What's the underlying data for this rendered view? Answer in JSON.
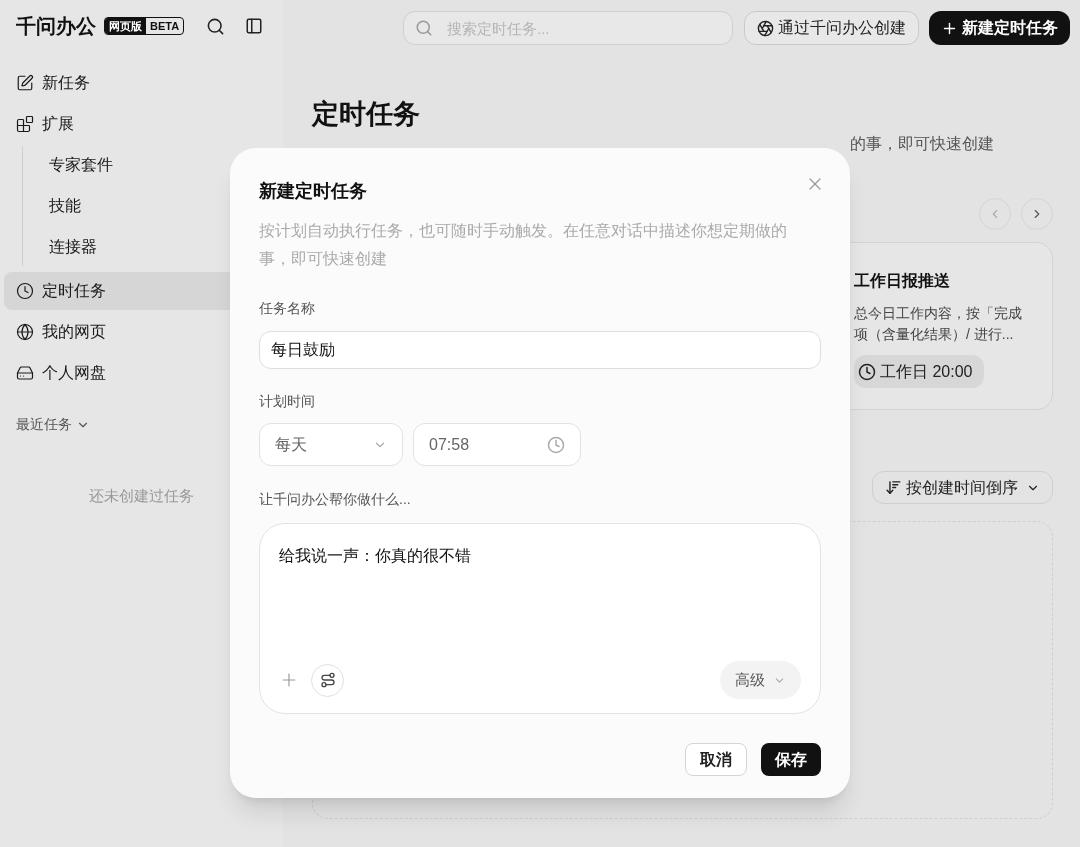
{
  "app": {
    "logo": "千问办公",
    "edition": "网页版",
    "stage": "BETA"
  },
  "sidebar": {
    "items": [
      {
        "label": "新任务",
        "selected": false
      },
      {
        "label": "扩展",
        "selected": false,
        "children": [
          {
            "label": "专家套件",
            "selected": false
          },
          {
            "label": "技能",
            "selected": false
          },
          {
            "label": "连接器",
            "selected": false
          }
        ]
      },
      {
        "label": "定时任务",
        "selected": true
      },
      {
        "label": "我的网页",
        "selected": false
      },
      {
        "label": "个人网盘",
        "selected": false
      }
    ],
    "recent": {
      "label": "最近任务",
      "empty_text": "还未创建过任务"
    }
  },
  "toolbar": {
    "search_placeholder": "搜索定时任务...",
    "secondary_button": "通过千问办公创建",
    "primary_button": "新建定时任务"
  },
  "page": {
    "title": "定时任务",
    "subtitle": "的事，即可快速创建"
  },
  "template_card": {
    "title": "工作日报推送",
    "description_lines": [
      "总今日工作内容，按「完成",
      "项（含量化结果）/ 进行..."
    ],
    "schedule": "工作日 20:00"
  },
  "sort_button": "按创建时间倒序",
  "dialog": {
    "title": "新建定时任务",
    "description": "按计划自动执行任务，也可随时手动触发。在任意对话中描述你想定期做的事，即可快速创建",
    "name_label": "任务名称",
    "name_value": "每日鼓励",
    "schedule_label": "计划时间",
    "frequency": "每天",
    "time": "07:58",
    "prompt_label": "让千问办公帮你做什么...",
    "prompt_value": "给我说一声：你真的很不错",
    "advanced": "高级",
    "cancel": "取消",
    "save": "保存"
  }
}
